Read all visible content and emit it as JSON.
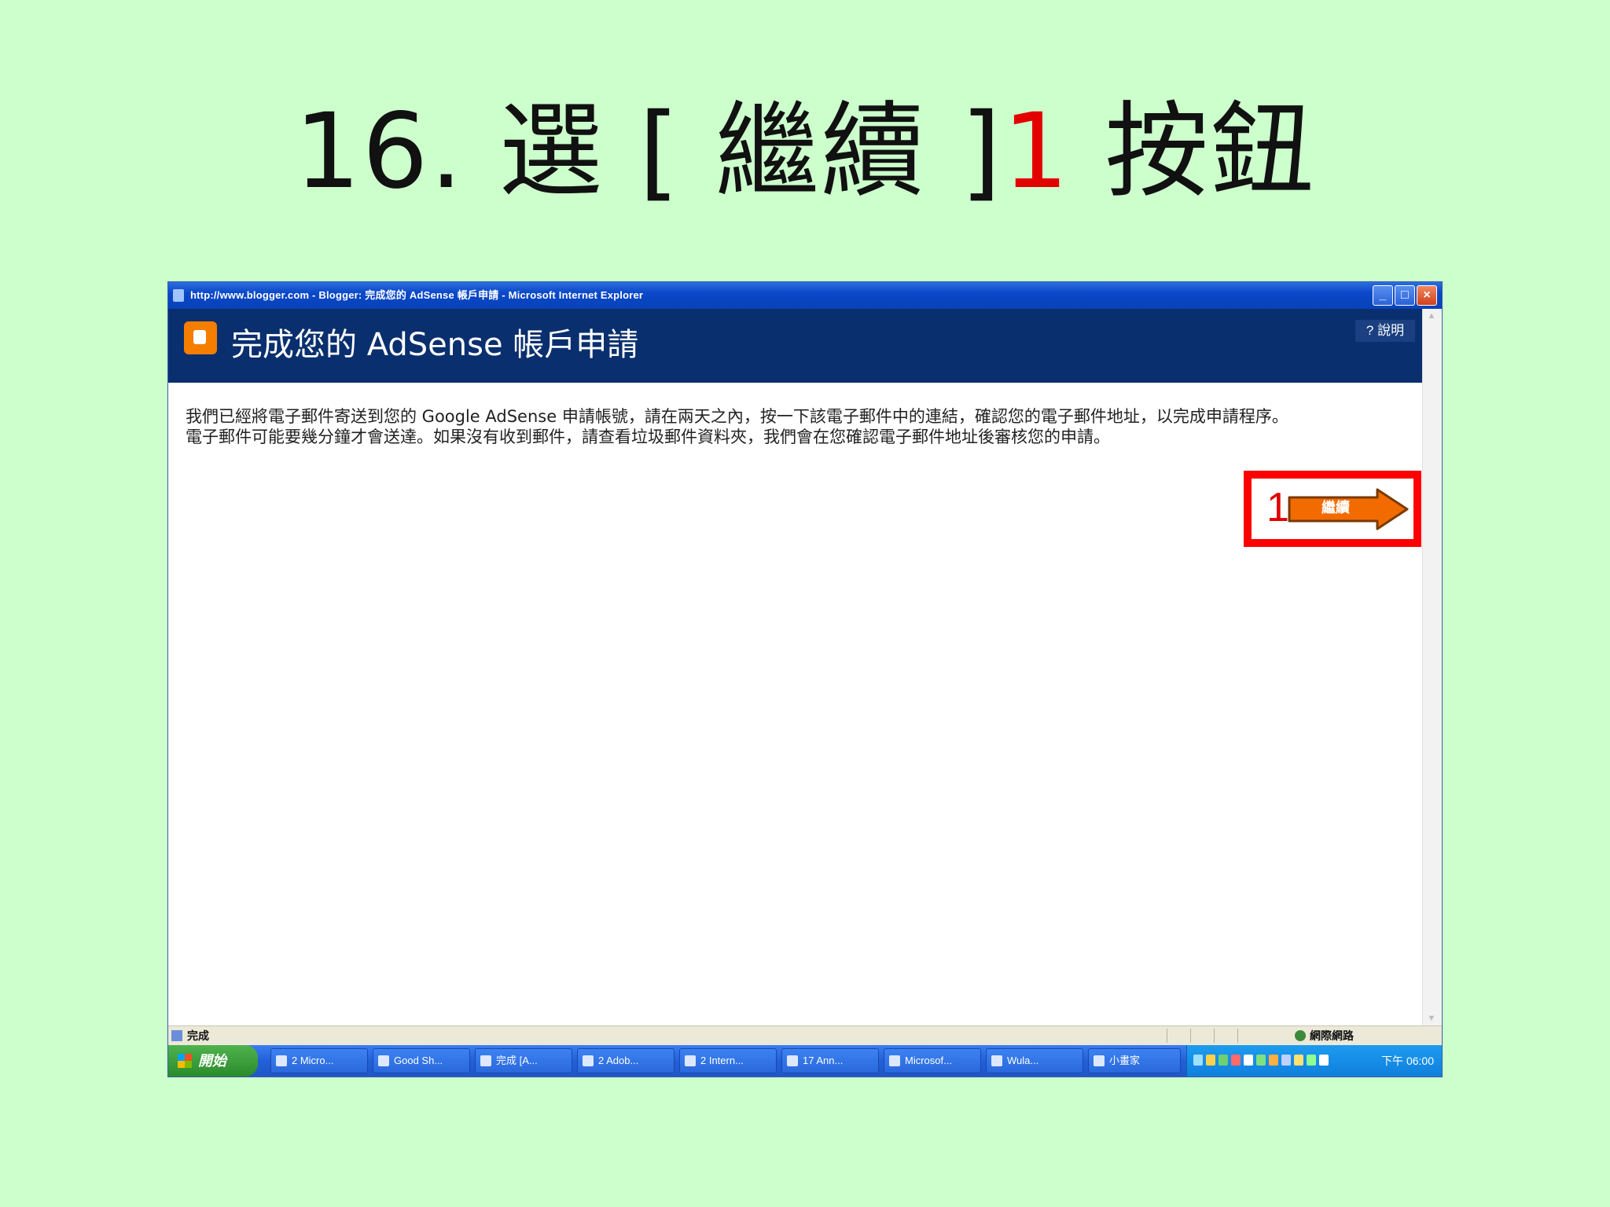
{
  "slide": {
    "title_main": "16. 選 [ 繼續 ]",
    "title_accent": "1",
    "title_end": " 按鈕"
  },
  "window": {
    "title": "http://www.blogger.com - Blogger: 完成您的 AdSense 帳戶申請 - Microsoft Internet Explorer",
    "controls": {
      "minimize": "_",
      "maximize": "□",
      "close": "×"
    }
  },
  "page": {
    "heading": "完成您的 AdSense 帳戶申請",
    "help_link": "? 說明",
    "body_line1": "我們已經將電子郵件寄送到您的 Google AdSense 申請帳號，請在兩天之內，按一下該電子郵件中的連結，確認您的電子郵件地址，以完成申請程序。",
    "body_line2": "電子郵件可能要幾分鐘才會送達。如果沒有收到郵件，請查看垃圾郵件資料夾，我們會在您確認電子郵件地址後審核您的申請。",
    "annotation_number": "1",
    "continue_label": "繼續"
  },
  "colors": {
    "slide_bg": "#ccffcc",
    "banner_bg": "#0a2f6e",
    "highlight": "#ff0000",
    "continue_arrow": "#f26b00"
  },
  "statusbar": {
    "status": "完成",
    "zone": "網際網路"
  },
  "taskbar": {
    "start_label": "開始",
    "tasks": [
      "2 Micro...",
      "Good Sh...",
      "完成 [A...",
      "2 Adob...",
      "2 Intern...",
      "17 Ann...",
      "Microsof...",
      "Wula...",
      "小畫家"
    ],
    "clock": "下午 06:00"
  }
}
